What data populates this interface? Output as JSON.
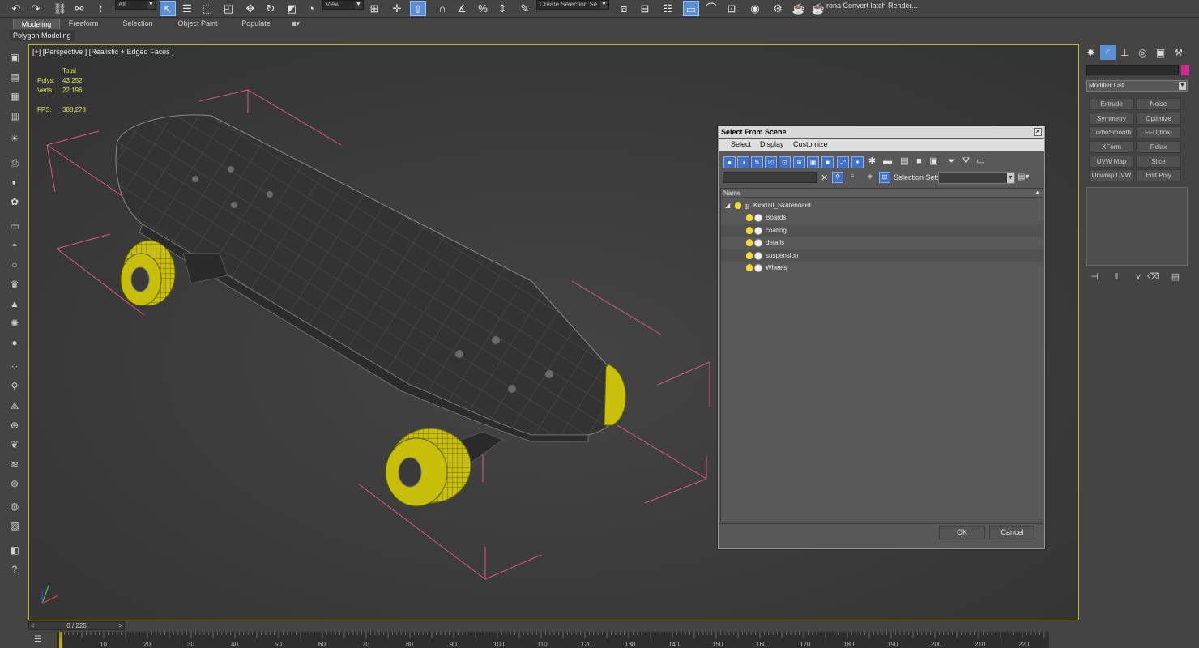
{
  "toolbar": {
    "filter_value": "All",
    "refcoord_value": "View",
    "selection_set_placeholder": "Create Selection Se",
    "render_label": "rona Convert latch Render..."
  },
  "ribbon": {
    "tabs": [
      "Modeling",
      "Freeform",
      "Selection",
      "Object Paint",
      "Populate"
    ],
    "active_tab": "Modeling",
    "sub_label": "Polygon Modeling"
  },
  "viewport": {
    "label": "[+] [Perspective ] [Realistic + Edged Faces ]",
    "stats": {
      "header": "Total",
      "polys_label": "Polys:",
      "polys_value": "43 252",
      "verts_label": "Verts:",
      "verts_value": "22 196",
      "fps_label": "FPS:",
      "fps_value": "388,278"
    }
  },
  "command_panel": {
    "modifier_list_label": "Modifier List",
    "modifiers": [
      [
        "Extrude",
        "Noise"
      ],
      [
        "Symmetry",
        "Optimize"
      ],
      [
        "TurboSmooth",
        "FFD(box)"
      ],
      [
        "XForm",
        "Relax"
      ],
      [
        "UVW Map",
        "Slice"
      ],
      [
        "Unwrap UVW",
        "Edit Poly"
      ]
    ],
    "accent_color": "#d02a8c"
  },
  "timeline": {
    "frame_display": "0 / 225",
    "tick_labels": [
      "10",
      "20",
      "30",
      "40",
      "50",
      "60",
      "70",
      "80",
      "90",
      "100",
      "110",
      "120",
      "130",
      "140",
      "150",
      "160",
      "170",
      "180",
      "190",
      "200",
      "210",
      "220"
    ]
  },
  "dialog": {
    "title": "Select From Scene",
    "menu": [
      "Select",
      "Display",
      "Customize"
    ],
    "selection_set_label": "Selection Set:",
    "column_header": "Name",
    "root": "Kicktail_Skateboard",
    "children": [
      "Boards",
      "coating",
      "details",
      "suspension",
      "Wheels"
    ],
    "ok_label": "OK",
    "cancel_label": "Cancel"
  }
}
